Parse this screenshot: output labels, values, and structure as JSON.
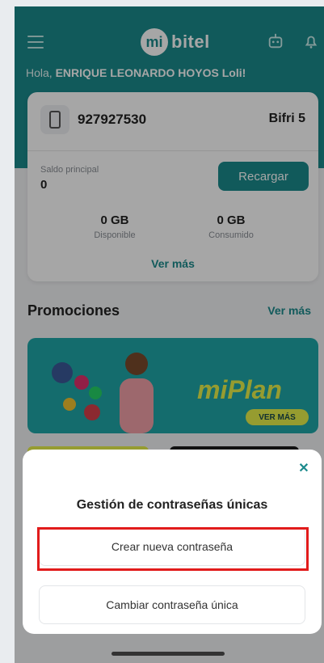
{
  "header": {
    "logo_mark": "mi",
    "logo_text": "bitel",
    "greeting_prefix": "Hola, ",
    "user_name": "ENRIQUE LEONARDO HOYOS Loli!"
  },
  "account": {
    "phone_number": "927927530",
    "plan_name": "Bifri 5",
    "saldo_label": "Saldo principal",
    "saldo_value": "0",
    "recharge_label": "Recargar",
    "available_value": "0 GB",
    "available_label": "Disponible",
    "consumed_value": "0 GB",
    "consumed_label": "Consumido",
    "see_more": "Ver más"
  },
  "promotions": {
    "title": "Promociones",
    "see_more": "Ver más",
    "banner_brand": "miPlan",
    "banner_button": "VER MÁS"
  },
  "sheet": {
    "title": "Gestión de contraseñas únicas",
    "options": [
      {
        "label": "Crear nueva contraseña"
      },
      {
        "label": "Cambiar contraseña única"
      }
    ],
    "close_icon": "close-icon"
  },
  "colors": {
    "brand": "#1b8a8c",
    "highlight": "#e11b1b",
    "accent": "#e7f04a"
  }
}
